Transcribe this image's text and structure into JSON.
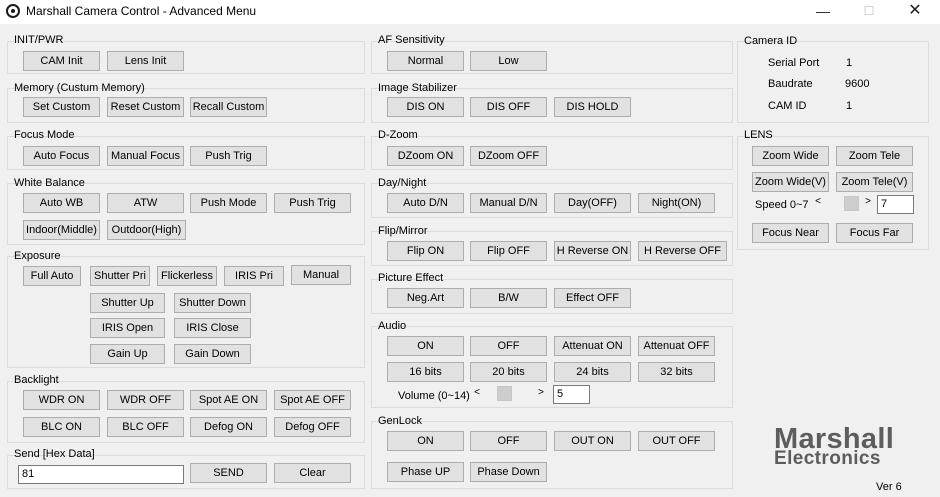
{
  "window": {
    "title": "Marshall Camera Control - Advanced Menu",
    "minimize": "—",
    "maximize": "☐",
    "close": "✕"
  },
  "init_pwr": {
    "title": "INIT/PWR",
    "cam_init": "CAM Init",
    "lens_init": "Lens Init"
  },
  "memory": {
    "title": "Memory (Custum Memory)",
    "set": "Set Custom",
    "reset": "Reset Custom",
    "recall": "Recall Custom"
  },
  "focus_mode": {
    "title": "Focus Mode",
    "auto": "Auto Focus",
    "manual": "Manual Focus",
    "push": "Push Trig"
  },
  "white_balance": {
    "title": "White Balance",
    "auto": "Auto WB",
    "atw": "ATW",
    "push_mode": "Push Mode",
    "push_trig": "Push Trig",
    "indoor": "Indoor(Middle)",
    "outdoor": "Outdoor(High)"
  },
  "exposure": {
    "title": "Exposure",
    "full_auto": "Full Auto",
    "shutter_pri": "Shutter Pri",
    "flickerless": "Flickerless",
    "iris_pri": "IRIS Pri",
    "manual": "Manual",
    "shutter_up": "Shutter Up",
    "shutter_down": "Shutter Down",
    "iris_open": "IRIS Open",
    "iris_close": "IRIS Close",
    "gain_up": "Gain Up",
    "gain_down": "Gain Down"
  },
  "backlight": {
    "title": "Backlight",
    "wdr_on": "WDR ON",
    "wdr_off": "WDR OFF",
    "spot_ae_on": "Spot AE ON",
    "spot_ae_off": "Spot AE OFF",
    "blc_on": "BLC ON",
    "blc_off": "BLC OFF",
    "defog_on": "Defog ON",
    "defog_off": "Defog OFF"
  },
  "send": {
    "title": "Send [Hex Data]",
    "value": "81",
    "send": "SEND",
    "clear": "Clear"
  },
  "af_sensitivity": {
    "title": "AF Sensitivity",
    "normal": "Normal",
    "low": "Low"
  },
  "stabilizer": {
    "title": "Image Stabilizer",
    "on": "DIS ON",
    "off": "DIS OFF",
    "hold": "DIS HOLD"
  },
  "dzoom": {
    "title": "D-Zoom",
    "on": "DZoom ON",
    "off": "DZoom OFF"
  },
  "day_night": {
    "title": "Day/Night",
    "auto": "Auto D/N",
    "manual": "Manual D/N",
    "day": "Day(OFF)",
    "night": "Night(ON)"
  },
  "flip_mirror": {
    "title": "Flip/Mirror",
    "flip_on": "Flip ON",
    "flip_off": "Flip OFF",
    "hrev_on": "H Reverse ON",
    "hrev_off": "H Reverse OFF"
  },
  "picture_effect": {
    "title": "Picture Effect",
    "neg": "Neg.Art",
    "bw": "B/W",
    "off": "Effect OFF"
  },
  "audio": {
    "title": "Audio",
    "on": "ON",
    "off": "OFF",
    "att_on": "Attenuat ON",
    "att_off": "Attenuat OFF",
    "b16": "16 bits",
    "b20": "20 bits",
    "b24": "24 bits",
    "b32": "32 bits",
    "volume_label": "Volume (0~14)",
    "left_arrow": "<",
    "right_arrow": ">",
    "volume_value": "5"
  },
  "genlock": {
    "title": "GenLock",
    "on": "ON",
    "off": "OFF",
    "out_on": "OUT ON",
    "out_off": "OUT OFF",
    "phase_up": "Phase UP",
    "phase_down": "Phase Down"
  },
  "camera_id": {
    "title": "Camera ID",
    "serial_label": "Serial Port",
    "serial_value": "1",
    "baud_label": "Baudrate",
    "baud_value": "9600",
    "camid_label": "CAM ID",
    "camid_value": "1"
  },
  "lens": {
    "title": "LENS",
    "zoom_wide": "Zoom Wide",
    "zoom_tele": "Zoom Tele",
    "zoom_wide_v": "Zoom Wide(V)",
    "zoom_tele_v": "Zoom Tele(V)",
    "speed_label": "Speed 0~7",
    "left_arrow": "<",
    "right_arrow": ">",
    "speed_value": "7",
    "focus_near": "Focus Near",
    "focus_far": "Focus Far"
  },
  "logo": {
    "line1": "Marshall",
    "line2": "Electronics"
  },
  "version": "Ver 6"
}
